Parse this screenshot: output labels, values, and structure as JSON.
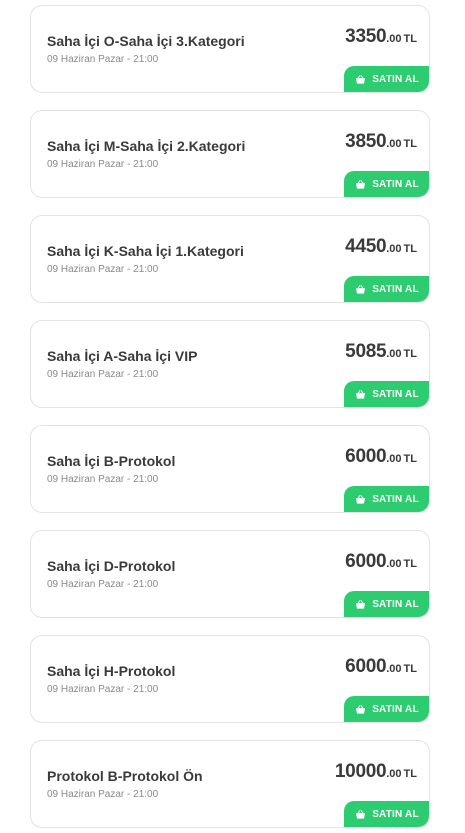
{
  "tickets": [
    {
      "title": "Saha İçi O-Saha İçi 3.Kategori",
      "date": "09 Haziran Pazar - 21:00",
      "price_main": "3350",
      "price_dec": ".00",
      "currency": "TL",
      "buy_label": "SATIN AL"
    },
    {
      "title": "Saha İçi M-Saha İçi 2.Kategori",
      "date": "09 Haziran Pazar - 21:00",
      "price_main": "3850",
      "price_dec": ".00",
      "currency": "TL",
      "buy_label": "SATIN AL"
    },
    {
      "title": "Saha İçi K-Saha İçi 1.Kategori",
      "date": "09 Haziran Pazar - 21:00",
      "price_main": "4450",
      "price_dec": ".00",
      "currency": "TL",
      "buy_label": "SATIN AL"
    },
    {
      "title": "Saha İçi A-Saha İçi VIP",
      "date": "09 Haziran Pazar - 21:00",
      "price_main": "5085",
      "price_dec": ".00",
      "currency": "TL",
      "buy_label": "SATIN AL"
    },
    {
      "title": "Saha İçi B-Protokol",
      "date": "09 Haziran Pazar - 21:00",
      "price_main": "6000",
      "price_dec": ".00",
      "currency": "TL",
      "buy_label": "SATIN AL"
    },
    {
      "title": "Saha İçi D-Protokol",
      "date": "09 Haziran Pazar - 21:00",
      "price_main": "6000",
      "price_dec": ".00",
      "currency": "TL",
      "buy_label": "SATIN AL"
    },
    {
      "title": "Saha İçi H-Protokol",
      "date": "09 Haziran Pazar - 21:00",
      "price_main": "6000",
      "price_dec": ".00",
      "currency": "TL",
      "buy_label": "SATIN AL"
    },
    {
      "title": "Protokol B-Protokol Ön",
      "date": "09 Haziran Pazar - 21:00",
      "price_main": "10000",
      "price_dec": ".00",
      "currency": "TL",
      "buy_label": "SATIN AL"
    }
  ],
  "colors": {
    "accent": "#2ecc71",
    "text": "#3a3a3a",
    "muted": "#8a8a8a",
    "border": "#e3e3e3"
  },
  "icons": {
    "buy": "basket-icon"
  }
}
